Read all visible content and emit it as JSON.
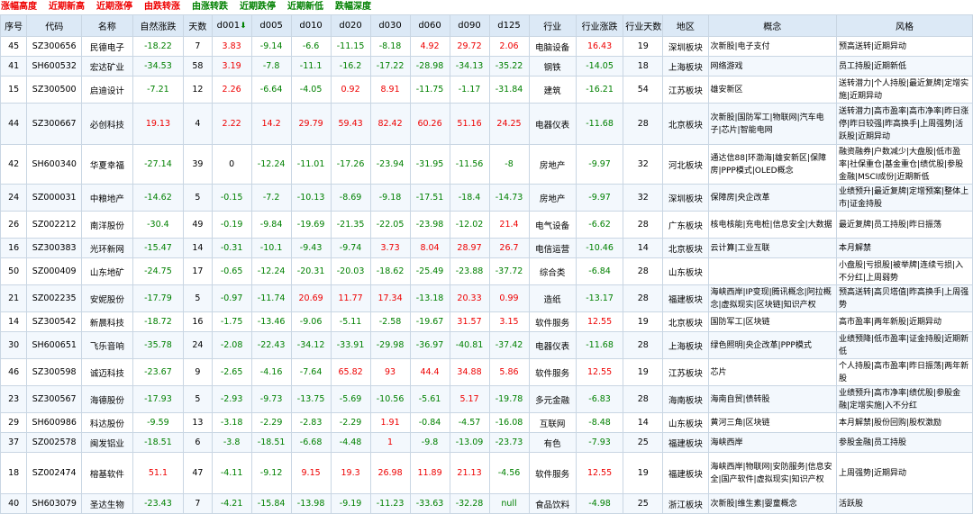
{
  "tabs": [
    {
      "label": "涨幅高度",
      "color": "red"
    },
    {
      "label": "近期新高",
      "color": "red"
    },
    {
      "label": "近期涨停",
      "color": "red"
    },
    {
      "label": "由跌转涨",
      "color": "red"
    },
    {
      "label": "由涨转跌",
      "color": "green"
    },
    {
      "label": "近期跌停",
      "color": "green"
    },
    {
      "label": "近期新低",
      "color": "green"
    },
    {
      "label": "跌幅深度",
      "color": "green"
    }
  ],
  "headers": [
    "序号",
    "代码",
    "名称",
    "自然涨跌",
    "天数",
    "d001",
    "d005",
    "d010",
    "d020",
    "d030",
    "d060",
    "d090",
    "d125",
    "行业",
    "行业涨跌",
    "行业天数",
    "地区",
    "概念",
    "风格"
  ],
  "sort_icon": "arrow-down-icon",
  "colors": {
    "up": "#e00000",
    "down": "#008000",
    "header_bg": "#dce9f6"
  },
  "rows": [
    {
      "h": 22,
      "cells": [
        "45",
        "SZ300656",
        "民德电子",
        "-18.22",
        "7",
        "3.83",
        "-9.14",
        "-6.6",
        "-11.15",
        "-8.18",
        "4.92",
        "29.72",
        "2.06",
        "电脑设备",
        "16.43",
        "19",
        "深圳板块",
        "次新股|电子支付",
        "预高送转|近期异动"
      ]
    },
    {
      "h": 22,
      "cells": [
        "41",
        "SH600532",
        "宏达矿业",
        "-34.53",
        "58",
        "3.19",
        "-7.8",
        "-11.1",
        "-16.2",
        "-17.22",
        "-28.98",
        "-34.13",
        "-35.22",
        "钢铁",
        "-14.05",
        "18",
        "上海板块",
        "网络游戏",
        "员工持股|近期新低"
      ]
    },
    {
      "h": 30,
      "cells": [
        "15",
        "SZ300500",
        "启迪设计",
        "-7.21",
        "12",
        "2.26",
        "-6.64",
        "-4.05",
        "0.92",
        "8.91",
        "-11.75",
        "-1.17",
        "-31.84",
        "建筑",
        "-16.21",
        "54",
        "江苏板块",
        "雄安新区",
        "送转潜力|个人持股|最近复牌|定增实施|近期异动"
      ]
    },
    {
      "h": 46,
      "cells": [
        "44",
        "SZ300667",
        "必创科技",
        "19.13",
        "4",
        "2.22",
        "14.2",
        "29.79",
        "59.43",
        "82.42",
        "60.26",
        "51.16",
        "24.25",
        "电器仪表",
        "-11.68",
        "28",
        "北京板块",
        "次新股|国防军工|物联网|汽车电子|芯片|智能电网",
        "送转潜力|高市盈率|高市净率|昨日涨停|昨日较强|昨高换手|上周强势|活跃股|近期异动"
      ]
    },
    {
      "h": 44,
      "cells": [
        "42",
        "SH600340",
        "华夏幸福",
        "-27.14",
        "39",
        "0",
        "-12.24",
        "-11.01",
        "-17.26",
        "-23.94",
        "-31.95",
        "-11.56",
        "-8",
        "房地产",
        "-9.97",
        "32",
        "河北板块",
        "通达信88|环渤海|雄安新区|保障房|PPP模式|OLED概念",
        "融资融券|户数减少|大盘股|低市盈率|社保重仓|基金重仓|绩优股|参股金融|MSCI成份|近期新低"
      ]
    },
    {
      "h": 30,
      "cells": [
        "24",
        "SZ000031",
        "中粮地产",
        "-14.62",
        "5",
        "-0.15",
        "-7.2",
        "-10.13",
        "-8.69",
        "-9.18",
        "-17.51",
        "-18.4",
        "-14.73",
        "房地产",
        "-9.97",
        "32",
        "深圳板块",
        "保障房|央企改革",
        "业绩预升|最近复牌|定增预案|整体上市|证金持股"
      ]
    },
    {
      "h": 30,
      "cells": [
        "26",
        "SZ002212",
        "南洋股份",
        "-30.4",
        "49",
        "-0.19",
        "-9.84",
        "-19.69",
        "-21.35",
        "-22.05",
        "-23.98",
        "-12.02",
        "21.4",
        "电气设备",
        "-6.62",
        "28",
        "广东板块",
        "核电核能|充电桩|信息安全|大数据",
        "最近复牌|员工持股|昨日振荡"
      ]
    },
    {
      "h": 22,
      "cells": [
        "16",
        "SZ300383",
        "光环新网",
        "-15.47",
        "14",
        "-0.31",
        "-10.1",
        "-9.43",
        "-9.74",
        "3.73",
        "8.04",
        "28.97",
        "26.7",
        "电信运营",
        "-10.46",
        "14",
        "北京板块",
        "云计算|工业互联",
        "本月解禁"
      ]
    },
    {
      "h": 30,
      "cells": [
        "50",
        "SZ000409",
        "山东地矿",
        "-24.75",
        "17",
        "-0.65",
        "-12.24",
        "-20.31",
        "-20.03",
        "-18.62",
        "-25.49",
        "-23.88",
        "-37.72",
        "综合类",
        "-6.84",
        "28",
        "山东板块",
        "",
        "小盘股|亏损股|被举牌|连续亏损|入不分红|上周弱势"
      ]
    },
    {
      "h": 30,
      "cells": [
        "21",
        "SZ002235",
        "安妮股份",
        "-17.79",
        "5",
        "-0.97",
        "-11.74",
        "20.69",
        "11.77",
        "17.34",
        "-13.18",
        "20.33",
        "0.99",
        "造纸",
        "-13.17",
        "28",
        "福建板块",
        "海峡西岸|IP变现|腾讯概念|阿拉概念|虚拟现实|区块链|知识产权",
        "预高送转|高贝塔值|昨高换手|上周强势"
      ]
    },
    {
      "h": 22,
      "cells": [
        "14",
        "SZ300542",
        "新晨科技",
        "-18.72",
        "16",
        "-1.75",
        "-13.46",
        "-9.06",
        "-5.11",
        "-2.58",
        "-19.67",
        "31.57",
        "3.15",
        "软件服务",
        "12.55",
        "19",
        "北京板块",
        "国防军工|区块链",
        "高市盈率|两年新股|近期异动"
      ]
    },
    {
      "h": 30,
      "cells": [
        "30",
        "SH600651",
        "飞乐音响",
        "-35.78",
        "24",
        "-2.08",
        "-22.43",
        "-34.12",
        "-33.91",
        "-29.98",
        "-36.97",
        "-40.81",
        "-37.42",
        "电器仪表",
        "-11.68",
        "28",
        "上海板块",
        "绿色照明|央企改革|PPP模式",
        "业绩预降|低市盈率|证金持股|近期新低"
      ]
    },
    {
      "h": 30,
      "cells": [
        "46",
        "SZ300598",
        "诚迈科技",
        "-23.67",
        "9",
        "-2.65",
        "-4.16",
        "-7.64",
        "65.82",
        "93",
        "44.4",
        "34.88",
        "5.86",
        "软件服务",
        "12.55",
        "19",
        "江苏板块",
        "芯片",
        "个人持股|高市盈率|昨日振荡|两年新股"
      ]
    },
    {
      "h": 30,
      "cells": [
        "23",
        "SZ300567",
        "海德股份",
        "-17.93",
        "5",
        "-2.93",
        "-9.73",
        "-13.75",
        "-5.69",
        "-10.56",
        "-5.61",
        "5.17",
        "-19.78",
        "多元金融",
        "-6.83",
        "28",
        "海南板块",
        "海南自贸|债转股",
        "业绩预升|高市净率|绩优股|参股金融|定增实施|入不分红"
      ]
    },
    {
      "h": 22,
      "cells": [
        "29",
        "SH600986",
        "科达股份",
        "-9.59",
        "13",
        "-3.18",
        "-2.29",
        "-2.83",
        "-2.29",
        "1.91",
        "-0.84",
        "-4.57",
        "-16.08",
        "互联网",
        "-8.48",
        "14",
        "山东板块",
        "黄河三角|区块链",
        "本月解禁|股份回购|股权激励"
      ]
    },
    {
      "h": 22,
      "cells": [
        "37",
        "SZ002578",
        "闽发铝业",
        "-18.51",
        "6",
        "-3.8",
        "-18.51",
        "-6.68",
        "-4.48",
        "1",
        "-9.8",
        "-13.09",
        "-23.73",
        "有色",
        "-7.93",
        "25",
        "福建板块",
        "海峡西岸",
        "参股金融|员工持股"
      ]
    },
    {
      "h": 46,
      "cells": [
        "18",
        "SZ002474",
        "榕基软件",
        "51.1",
        "47",
        "-4.11",
        "-9.12",
        "9.15",
        "19.3",
        "26.98",
        "11.89",
        "21.13",
        "-4.56",
        "软件服务",
        "12.55",
        "19",
        "福建板块",
        "海峡西岸|物联网|安防服务|信息安全|国产软件|虚拟现实|知识产权",
        "上周强势|近期异动"
      ]
    },
    {
      "h": 22,
      "cells": [
        "40",
        "SH603079",
        "圣达生物",
        "-23.43",
        "7",
        "-4.21",
        "-15.84",
        "-13.98",
        "-9.19",
        "-11.23",
        "-33.63",
        "-32.28",
        "null",
        "食品饮料",
        "-4.98",
        "25",
        "浙江板块",
        "次新股|维生素|婴童概念",
        "活跃股"
      ]
    }
  ]
}
